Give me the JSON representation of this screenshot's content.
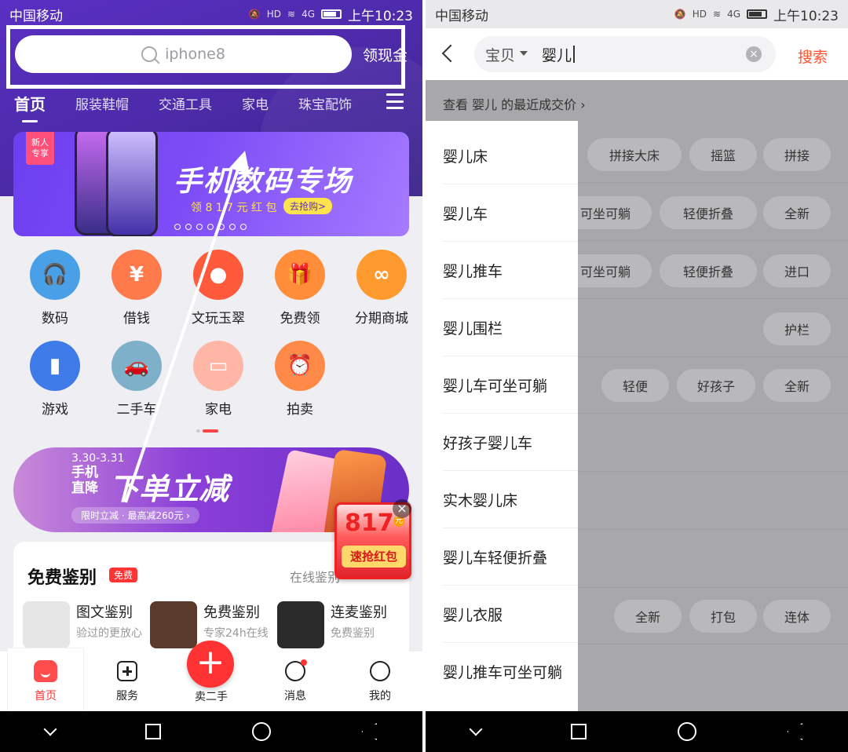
{
  "left": {
    "status": {
      "carrier": "中国移动",
      "time": "上午10:23",
      "hd": "HD",
      "net": "4G"
    },
    "search": {
      "placeholder": "iphone8",
      "cash_link": "领现金"
    },
    "categories": [
      "首页",
      "服装鞋帽",
      "交通工具",
      "家电",
      "珠宝配饰"
    ],
    "banner1": {
      "badge": "新人专享",
      "title": "手机数码专场",
      "subtitle": "领 8 1 7 元 红 包",
      "cta": "去抢购>"
    },
    "grid": [
      {
        "label": "数码",
        "icon": "headphones-icon",
        "color": "#4aa0e6",
        "glyph": "🎧"
      },
      {
        "label": "借钱",
        "icon": "yen-coin-icon",
        "color": "#ff7a4a",
        "glyph": "¥"
      },
      {
        "label": "文玩玉翠",
        "icon": "jade-pendant-icon",
        "color": "#ff5a3c",
        "glyph": "●"
      },
      {
        "label": "免费领",
        "icon": "gift-box-icon",
        "color": "#ff8d3a",
        "glyph": "🎁"
      },
      {
        "label": "分期商城",
        "icon": "installment-icon",
        "color": "#ff9a2e",
        "glyph": "∞"
      },
      {
        "label": "游戏",
        "icon": "gamepad-icon",
        "color": "#3f7be8",
        "glyph": "▮"
      },
      {
        "label": "二手车",
        "icon": "car-icon",
        "color": "#7fb0c9",
        "glyph": "🚗"
      },
      {
        "label": "家电",
        "icon": "appliance-icon",
        "color": "#ffb6a6",
        "glyph": "▭"
      },
      {
        "label": "拍卖",
        "icon": "alarm-clock-icon",
        "color": "#ff8a48",
        "glyph": "⏰"
      }
    ],
    "banner2": {
      "date": "3.30-3.31",
      "small": "手机直降",
      "big": "下单立减",
      "pill": "限时立减 · 最高减260元 ›"
    },
    "redpack": {
      "amount": "817",
      "unit": "元",
      "button": "速抢红包"
    },
    "appraisal": {
      "title": "免费鉴别",
      "badge": "免费",
      "more": "在线鉴别",
      "items": [
        {
          "title": "图文鉴别",
          "sub": "验过的更放心"
        },
        {
          "title": "免费鉴别",
          "sub": "专家24h在线"
        },
        {
          "title": "连麦鉴别",
          "sub": "免费鉴别"
        }
      ]
    },
    "tabs": [
      "首页",
      "服务",
      "卖二手",
      "消息",
      "我的"
    ]
  },
  "right": {
    "status": {
      "carrier": "中国移动",
      "time": "上午10:23",
      "hd": "HD",
      "net": "4G"
    },
    "search": {
      "scope": "宝贝",
      "query": "婴儿",
      "button": "搜索"
    },
    "recent_link": "查看 婴儿 的最近成交价 ›",
    "suggestions": [
      "婴儿床",
      "婴儿车",
      "婴儿推车",
      "婴儿围栏",
      "婴儿车可坐可躺",
      "好孩子婴儿车",
      "实木婴儿床",
      "婴儿车轻便折叠",
      "婴儿衣服",
      "婴儿推车可坐可躺"
    ],
    "chips": {
      "row1": [
        "拼接大床",
        "摇篮",
        "拼接"
      ],
      "row2": [
        "可坐可躺",
        "轻便折叠",
        "全新"
      ],
      "row3": [
        "可坐可躺",
        "轻便折叠",
        "进口"
      ],
      "row4": [
        "护栏"
      ],
      "row5": [
        "轻便",
        "好孩子",
        "全新"
      ],
      "row9": [
        "全新",
        "打包",
        "连体"
      ]
    }
  }
}
